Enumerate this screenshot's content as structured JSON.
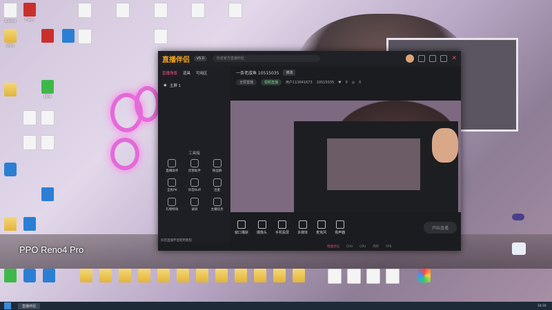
{
  "desktop": {
    "left_column": [
      {
        "label": "1.docx",
        "type": "doc"
      },
      {
        "label": "Flash",
        "type": "red"
      },
      {
        "label": "WPS",
        "type": "folder"
      },
      {
        "label": "",
        "type": "red"
      },
      {
        "label": "",
        "type": "blue"
      },
      {
        "label": "MP4",
        "type": "green"
      }
    ],
    "overlay_text": "PPO Reno4 Pro"
  },
  "app": {
    "logo": "直播伴侣",
    "version": "v5.0",
    "search_placeholder": "抖音官方直播伴侣",
    "left_tabs": [
      "直播场景",
      "道具",
      "可用区"
    ],
    "scene_label": "主屏 1",
    "tools_title": "工具箱",
    "tools": [
      "直播助手",
      "房管助手",
      "粉丝群",
      "全民PK",
      "抖音Buff",
      "连麦",
      "礼物特效",
      "录屏",
      "主播任务"
    ],
    "left_footer": "抖音直播伴侣使用教程",
    "room": {
      "title": "一条老咸鱼 10515035",
      "edit_label": "修改",
      "mode_chip": "全屏直播",
      "category_chip": "视频直播",
      "user_id": "用户113641673",
      "room_id": "10515035",
      "likes": "0",
      "viewers": "0"
    },
    "bottom_tools": [
      "窗口捕获",
      "摄像头",
      "手机投屏",
      "多媒体",
      "麦克风",
      "扬声器"
    ],
    "start_live_label": "开始直播",
    "status": {
      "perf": "性能优化",
      "cpu1": "CPU",
      "cpu2": "CPU",
      "mem": "内存",
      "fps": "FPS"
    }
  },
  "taskbar": {
    "task_label": "直播伴侣",
    "clock": "14:31"
  }
}
